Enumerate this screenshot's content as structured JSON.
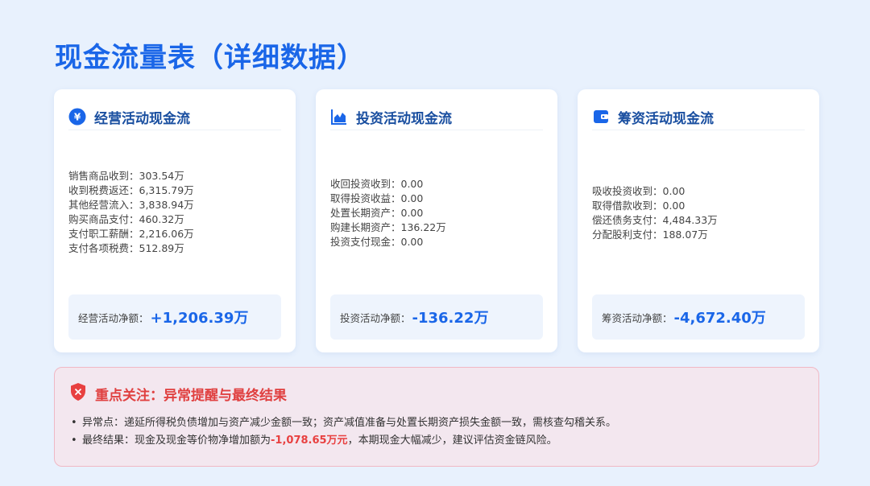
{
  "page": {
    "title": "现金流量表（详细数据）"
  },
  "cards": [
    {
      "title": "经营活动现金流",
      "icon": "yen-circle-icon",
      "lines": [
        "销售商品收到：303.54万",
        "收到税费返还：6,315.79万",
        "其他经营流入：3,838.94万",
        "购买商品支付：460.32万",
        "支付职工薪酬：2,216.06万",
        "支付各项税费：512.89万"
      ],
      "net_label": "经营活动净额：",
      "net_value": "+1,206.39万"
    },
    {
      "title": "投资活动现金流",
      "icon": "area-chart-icon",
      "lines": [
        "收回投资收到：0.00",
        "取得投资收益：0.00",
        "处置长期资产：0.00",
        "购建长期资产：136.22万",
        "投资支付现金：0.00"
      ],
      "net_label": "投资活动净额：",
      "net_value": "-136.22万"
    },
    {
      "title": "筹资活动现金流",
      "icon": "wallet-icon",
      "lines": [
        "吸收投资收到：0.00",
        "取得借款收到：0.00",
        "偿还债务支付：4,484.33万",
        "分配股利支付：188.07万"
      ],
      "net_label": "筹资活动净额：",
      "net_value": "-4,672.40万"
    }
  ],
  "alert": {
    "title": "重点关注：异常提醒与最终结果",
    "icon": "shield-x-icon",
    "bullet": "•",
    "item1": "异常点：递延所得税负债增加与资产减少金额一致；资产减值准备与处置长期资产损失金额一致，需核查勾稽关系。",
    "item2_prefix": "最终结果：现金及现金等价物净增加额为",
    "item2_highlight": "-1,078.65万元",
    "item2_suffix": "，本期现金大幅减少，建议评估资金链风险。"
  },
  "colors": {
    "accent": "#1a66e8",
    "danger": "#e84040",
    "background": "#e8f1fd"
  }
}
